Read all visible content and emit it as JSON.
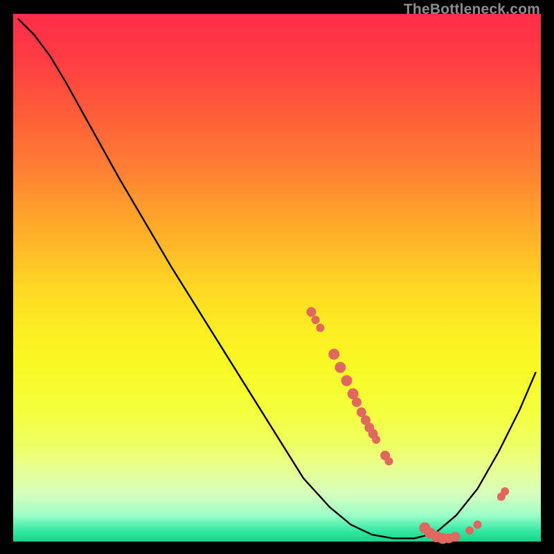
{
  "watermark": "TheBottleneck.com",
  "colors": {
    "curve": "#000000",
    "marker": "#e0695f"
  },
  "chart_data": {
    "type": "line",
    "title": "",
    "xlabel": "",
    "ylabel": "",
    "xlim": [
      0,
      100
    ],
    "ylim": [
      0,
      100
    ],
    "curve_points": [
      {
        "x": 1,
        "y": 99
      },
      {
        "x": 4,
        "y": 96
      },
      {
        "x": 7,
        "y": 92
      },
      {
        "x": 10,
        "y": 87
      },
      {
        "x": 15,
        "y": 78
      },
      {
        "x": 20,
        "y": 69
      },
      {
        "x": 30,
        "y": 52
      },
      {
        "x": 40,
        "y": 36
      },
      {
        "x": 50,
        "y": 20
      },
      {
        "x": 55,
        "y": 12
      },
      {
        "x": 60,
        "y": 6.5
      },
      {
        "x": 64,
        "y": 3.2
      },
      {
        "x": 68,
        "y": 1.3
      },
      {
        "x": 72,
        "y": 0.6
      },
      {
        "x": 76,
        "y": 0.6
      },
      {
        "x": 80,
        "y": 1.6
      },
      {
        "x": 84,
        "y": 5
      },
      {
        "x": 88,
        "y": 10
      },
      {
        "x": 92,
        "y": 17
      },
      {
        "x": 96,
        "y": 25
      },
      {
        "x": 99,
        "y": 32
      }
    ],
    "markers": [
      {
        "x": 56.5,
        "y": 43.5,
        "r": 7
      },
      {
        "x": 57.3,
        "y": 42.0,
        "r": 6
      },
      {
        "x": 58.2,
        "y": 40.5,
        "r": 6
      },
      {
        "x": 60.8,
        "y": 35.5,
        "r": 8
      },
      {
        "x": 62.0,
        "y": 33.0,
        "r": 8
      },
      {
        "x": 63.2,
        "y": 30.5,
        "r": 8
      },
      {
        "x": 64.4,
        "y": 28.0,
        "r": 8
      },
      {
        "x": 65.1,
        "y": 26.4,
        "r": 7
      },
      {
        "x": 66.0,
        "y": 24.5,
        "r": 7
      },
      {
        "x": 66.8,
        "y": 23.0,
        "r": 7
      },
      {
        "x": 67.5,
        "y": 21.6,
        "r": 7
      },
      {
        "x": 68.2,
        "y": 20.4,
        "r": 7
      },
      {
        "x": 68.8,
        "y": 19.3,
        "r": 6
      },
      {
        "x": 70.5,
        "y": 16.3,
        "r": 7
      },
      {
        "x": 71.2,
        "y": 15.2,
        "r": 6
      },
      {
        "x": 78.0,
        "y": 2.6,
        "r": 8
      },
      {
        "x": 79.0,
        "y": 1.6,
        "r": 8
      },
      {
        "x": 80.2,
        "y": 0.9,
        "r": 8
      },
      {
        "x": 81.4,
        "y": 0.6,
        "r": 8
      },
      {
        "x": 82.6,
        "y": 0.6,
        "r": 7
      },
      {
        "x": 83.8,
        "y": 0.9,
        "r": 7
      },
      {
        "x": 86.5,
        "y": 2.1,
        "r": 6
      },
      {
        "x": 88.0,
        "y": 3.2,
        "r": 6
      },
      {
        "x": 92.5,
        "y": 8.5,
        "r": 6
      },
      {
        "x": 93.2,
        "y": 9.5,
        "r": 6
      }
    ]
  }
}
